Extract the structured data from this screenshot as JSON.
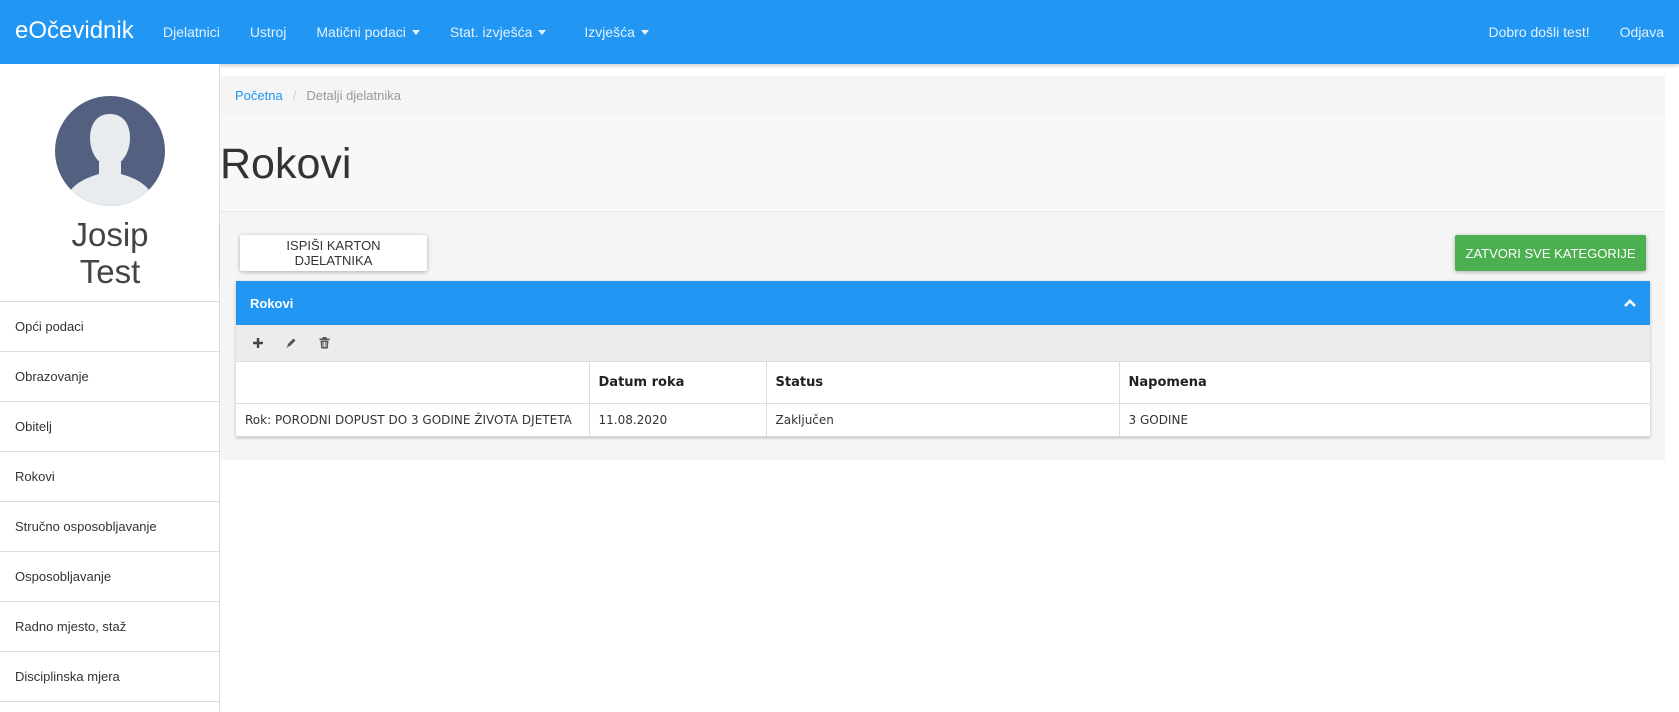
{
  "navbar": {
    "brand": "eOčevidnik",
    "items": [
      {
        "label": "Djelatnici"
      },
      {
        "label": "Ustroj"
      },
      {
        "label": "Matični podaci"
      },
      {
        "label": "Stat. izvješća"
      },
      {
        "label": "Izvješća"
      }
    ],
    "welcome": "Dobro došli test!",
    "logout": "Odjava"
  },
  "sidebar": {
    "first_name": "Josip",
    "last_name": "Test",
    "menu": [
      {
        "label": "Opći podaci"
      },
      {
        "label": "Obrazovanje"
      },
      {
        "label": "Obitelj"
      },
      {
        "label": "Rokovi"
      },
      {
        "label": "Stručno osposobljavanje"
      },
      {
        "label": "Osposobljavanje"
      },
      {
        "label": "Radno mjesto, staž"
      },
      {
        "label": "Disciplinska mjera"
      }
    ]
  },
  "breadcrumb": {
    "home": "Početna",
    "separator": "/",
    "current": "Detalji djelatnika"
  },
  "page": {
    "title": "Rokovi",
    "print_button": "ISPIŠI KARTON DJELATNIKA",
    "close_all_button": "ZATVORI SVE KATEGORIJE"
  },
  "panel": {
    "title": "Rokovi",
    "columns": [
      "",
      "Datum roka",
      "Status",
      "Napomena"
    ],
    "rows": [
      [
        "Rok: PORODNI DOPUST DO 3 GODINE ŽIVOTA DJETETA",
        "11.08.2020",
        "Zaključen",
        "3 GODINE"
      ]
    ]
  },
  "colors": {
    "primary": "#2196f3",
    "success": "#4caf50",
    "avatar": "#536080"
  }
}
